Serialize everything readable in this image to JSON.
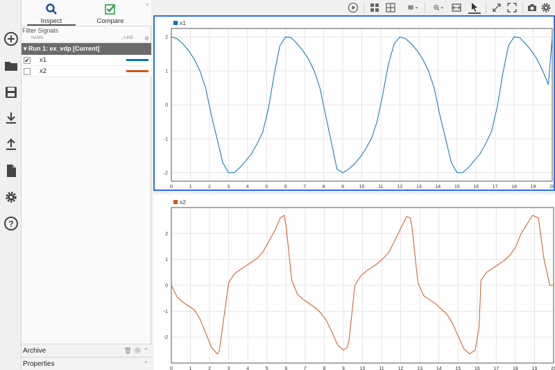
{
  "panel": {
    "tabs": [
      {
        "label": "Inspect",
        "icon": "magnifier-icon"
      },
      {
        "label": "Compare",
        "icon": "check-icon"
      }
    ],
    "filter_label": "Filter Signals",
    "columns": {
      "name": "NAME",
      "line": "LINE"
    },
    "run_label": "Run 1: ex_vdp [Current]",
    "signals": [
      {
        "name": "x1",
        "checked": true,
        "checkmark": "✔",
        "color": "#0072bd"
      },
      {
        "name": "x2",
        "checked": false,
        "checkmark": "",
        "color": "#d95319"
      }
    ],
    "archive_label": "Archive",
    "properties_label": "Properties"
  },
  "colors": {
    "accent": "#2b6fe5",
    "x1": "#0072bd",
    "x2": "#d95319"
  },
  "chart_data": [
    {
      "type": "line",
      "series": [
        {
          "name": "x1",
          "x": [
            0,
            0.3,
            0.6,
            0.9,
            1.2,
            1.5,
            1.8,
            2.1,
            2.4,
            2.7,
            3.0,
            3.3,
            3.6,
            3.9,
            4.2,
            4.5,
            4.8,
            5.1,
            5.4,
            5.7,
            6.0,
            6.3,
            6.6,
            6.9,
            7.2,
            7.5,
            7.8,
            8.1,
            8.4,
            8.7,
            9.0,
            9.3,
            9.6,
            9.9,
            10.2,
            10.5,
            10.8,
            11.1,
            11.4,
            11.7,
            12.0,
            12.3,
            12.6,
            12.9,
            13.2,
            13.5,
            13.8,
            14.1,
            14.4,
            14.7,
            15.0,
            15.3,
            15.6,
            15.9,
            16.2,
            16.5,
            16.8,
            17.1,
            17.4,
            17.7,
            18.0,
            18.3,
            18.6,
            18.9,
            19.2,
            19.5,
            19.8,
            20.0
          ],
          "y": [
            2.0,
            1.95,
            1.8,
            1.6,
            1.35,
            1.0,
            0.5,
            -0.3,
            -1.0,
            -1.7,
            -2.0,
            -2.0,
            -1.85,
            -1.65,
            -1.45,
            -1.15,
            -0.8,
            -0.1,
            0.9,
            1.75,
            2.0,
            1.98,
            1.8,
            1.6,
            1.35,
            1.0,
            0.5,
            -0.3,
            -1.1,
            -1.9,
            -2.0,
            -1.9,
            -1.75,
            -1.55,
            -1.3,
            -1.0,
            -0.5,
            0.3,
            1.2,
            1.8,
            2.0,
            1.95,
            1.8,
            1.6,
            1.35,
            1.0,
            0.5,
            -0.3,
            -1.0,
            -1.7,
            -2.0,
            -2.0,
            -1.85,
            -1.65,
            -1.45,
            -1.15,
            -0.8,
            -0.1,
            0.9,
            1.75,
            2.0,
            1.98,
            1.8,
            1.6,
            1.35,
            1.0,
            0.6,
            2.0
          ]
        }
      ],
      "xlim": [
        0,
        20
      ],
      "ylim": [
        -2.25,
        2.25
      ],
      "xticks": [
        0,
        1,
        2,
        3,
        4,
        5,
        6,
        7,
        8,
        9,
        10,
        11,
        12,
        13,
        14,
        15,
        16,
        17,
        18,
        19,
        20
      ],
      "yticks": [
        -2,
        -1,
        0,
        1,
        2
      ],
      "legend": "top-left",
      "grid": true
    },
    {
      "type": "line",
      "series": [
        {
          "name": "x2",
          "x": [
            0,
            0.3,
            0.6,
            0.9,
            1.2,
            1.5,
            1.8,
            2.1,
            2.4,
            2.5,
            2.7,
            3.0,
            3.3,
            3.6,
            3.9,
            4.2,
            4.5,
            4.8,
            5.1,
            5.4,
            5.7,
            5.9,
            6.0,
            6.3,
            6.6,
            6.9,
            7.2,
            7.5,
            7.8,
            8.1,
            8.4,
            8.7,
            9.0,
            9.2,
            9.3,
            9.6,
            9.9,
            10.2,
            10.5,
            10.8,
            11.1,
            11.4,
            11.7,
            12.0,
            12.3,
            12.5,
            12.6,
            12.9,
            13.2,
            13.5,
            13.8,
            14.1,
            14.4,
            14.7,
            15.0,
            15.3,
            15.6,
            15.9,
            16.1,
            16.2,
            16.5,
            16.8,
            17.1,
            17.4,
            17.7,
            18.0,
            18.3,
            18.6,
            18.9,
            19.2,
            19.5,
            19.8,
            20.0
          ],
          "y": [
            0,
            -0.45,
            -0.65,
            -0.8,
            -0.95,
            -1.3,
            -1.85,
            -2.4,
            -2.65,
            -2.55,
            -1.5,
            0.1,
            0.45,
            0.6,
            0.75,
            0.9,
            1.05,
            1.3,
            1.7,
            2.1,
            2.6,
            2.7,
            2.3,
            0.2,
            -0.35,
            -0.55,
            -0.7,
            -0.85,
            -1.05,
            -1.35,
            -1.8,
            -2.3,
            -2.5,
            -2.4,
            -2.1,
            0.0,
            0.35,
            0.55,
            0.7,
            0.85,
            1.05,
            1.3,
            1.75,
            2.2,
            2.65,
            2.6,
            2.2,
            0.1,
            -0.4,
            -0.55,
            -0.7,
            -0.9,
            -1.1,
            -1.45,
            -1.95,
            -2.45,
            -2.65,
            -2.5,
            -1.6,
            0.2,
            0.5,
            0.65,
            0.8,
            0.95,
            1.15,
            1.45,
            2.0,
            2.35,
            2.7,
            2.6,
            1.0,
            0.0,
            0.0
          ]
        }
      ],
      "xlim": [
        0,
        20
      ],
      "ylim": [
        -3.0,
        3.0
      ],
      "xticks": [
        0,
        1,
        2,
        3,
        4,
        5,
        6,
        7,
        8,
        9,
        10,
        11,
        12,
        13,
        14,
        15,
        16,
        17,
        18,
        19,
        20
      ],
      "yticks": [
        -2,
        -1,
        0,
        1,
        2
      ],
      "legend": "top-left",
      "grid": true
    }
  ]
}
